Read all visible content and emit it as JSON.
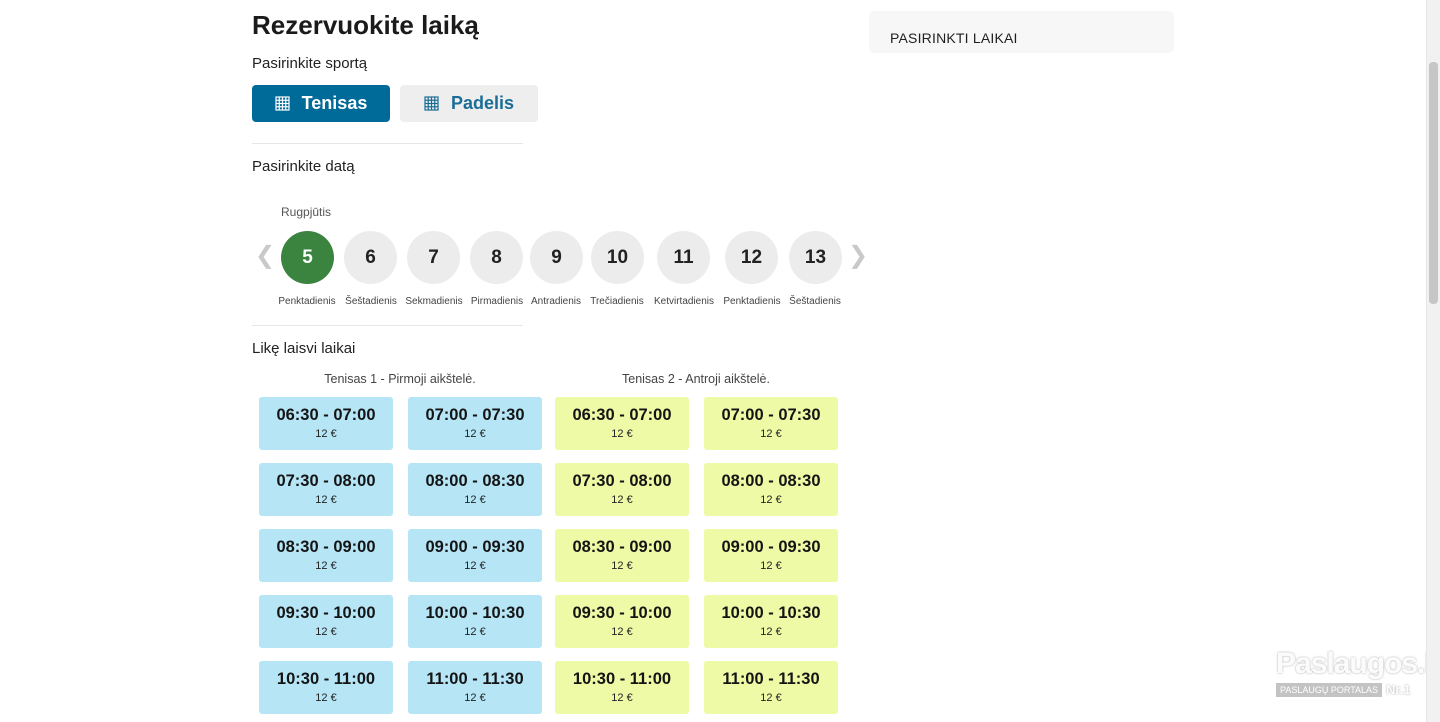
{
  "page": {
    "title": "Rezervuokite laiką"
  },
  "sport": {
    "label": "Pasirinkite sportą",
    "options": [
      {
        "label": "Tenisas",
        "icon": "grid-court-icon",
        "selected": true
      },
      {
        "label": "Padelis",
        "icon": "grid-court-icon",
        "selected": false
      }
    ]
  },
  "date": {
    "label": "Pasirinkite datą",
    "month": "Rugpjūtis",
    "prev_icon": "chevron-left-icon",
    "next_icon": "chevron-right-icon",
    "days": [
      {
        "day": "5",
        "weekday": "Penktadienis",
        "selected": true
      },
      {
        "day": "6",
        "weekday": "Šeštadienis",
        "selected": false
      },
      {
        "day": "7",
        "weekday": "Sekmadienis",
        "selected": false
      },
      {
        "day": "8",
        "weekday": "Pirmadienis",
        "selected": false
      },
      {
        "day": "9",
        "weekday": "Antradienis",
        "selected": false
      },
      {
        "day": "10",
        "weekday": "Trečiadienis",
        "selected": false
      },
      {
        "day": "11",
        "weekday": "Ketvirtadienis",
        "selected": false
      },
      {
        "day": "12",
        "weekday": "Penktadienis",
        "selected": false
      },
      {
        "day": "13",
        "weekday": "Šeštadienis",
        "selected": false
      }
    ]
  },
  "slots": {
    "label": "Likę laisvi laikai",
    "courts": [
      {
        "name": "Tenisas 1 - Pirmoji aikštelė.",
        "color": "#b6e5f6",
        "slots": [
          {
            "time": "06:30 - 07:00",
            "price": "12 €"
          },
          {
            "time": "07:00 - 07:30",
            "price": "12 €"
          },
          {
            "time": "07:30 - 08:00",
            "price": "12 €"
          },
          {
            "time": "08:00 - 08:30",
            "price": "12 €"
          },
          {
            "time": "08:30 - 09:00",
            "price": "12 €"
          },
          {
            "time": "09:00 - 09:30",
            "price": "12 €"
          },
          {
            "time": "09:30 - 10:00",
            "price": "12 €"
          },
          {
            "time": "10:00 - 10:30",
            "price": "12 €"
          },
          {
            "time": "10:30 - 11:00",
            "price": "12 €"
          },
          {
            "time": "11:00 - 11:30",
            "price": "12 €"
          }
        ]
      },
      {
        "name": "Tenisas 2 - Antroji aikštelė.",
        "color": "#eefaa6",
        "slots": [
          {
            "time": "06:30 - 07:00",
            "price": "12 €"
          },
          {
            "time": "07:00 - 07:30",
            "price": "12 €"
          },
          {
            "time": "07:30 - 08:00",
            "price": "12 €"
          },
          {
            "time": "08:00 - 08:30",
            "price": "12 €"
          },
          {
            "time": "08:30 - 09:00",
            "price": "12 €"
          },
          {
            "time": "09:00 - 09:30",
            "price": "12 €"
          },
          {
            "time": "09:30 - 10:00",
            "price": "12 €"
          },
          {
            "time": "10:00 - 10:30",
            "price": "12 €"
          },
          {
            "time": "10:30 - 11:00",
            "price": "12 €"
          },
          {
            "time": "11:00 - 11:30",
            "price": "12 €"
          }
        ]
      }
    ]
  },
  "summary": {
    "title": "PASIRINKTI LAIKAI"
  },
  "watermark": {
    "logo": "Paslaugos.lt",
    "tagline": "PASLAUGŲ PORTALAS",
    "rank": "Nr.1"
  },
  "colors": {
    "primary": "#006a98",
    "selected_day": "#3b8440",
    "court1": "#b6e5f6",
    "court2": "#eefaa6"
  }
}
